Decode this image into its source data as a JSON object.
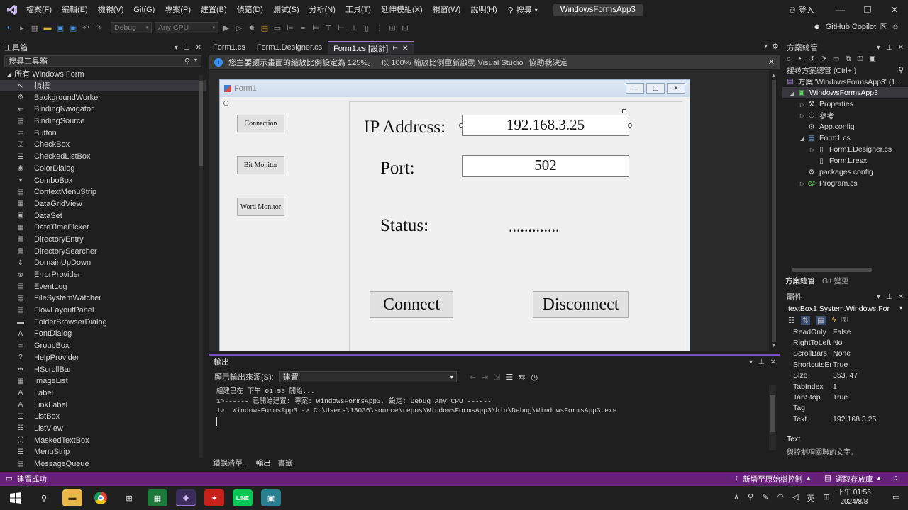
{
  "titlebar": {
    "menu": [
      "檔案(F)",
      "編輯(E)",
      "檢視(V)",
      "Git(G)",
      "專案(P)",
      "建置(B)",
      "偵錯(D)",
      "測試(S)",
      "分析(N)",
      "工具(T)",
      "延伸模組(X)",
      "視窗(W)",
      "說明(H)"
    ],
    "search_label": "搜尋",
    "solution_name": "WindowsFormsApp3",
    "signin": "登入"
  },
  "toolbar": {
    "config": "Debug",
    "platform": "Any CPU",
    "copilot": "GitHub Copilot"
  },
  "toolbox": {
    "title": "工具箱",
    "search_placeholder": "搜尋工具箱",
    "group": "所有 Windows Form",
    "items": [
      "指標",
      "BackgroundWorker",
      "BindingNavigator",
      "BindingSource",
      "Button",
      "CheckBox",
      "CheckedListBox",
      "ColorDialog",
      "ComboBox",
      "ContextMenuStrip",
      "DataGridView",
      "DataSet",
      "DateTimePicker",
      "DirectoryEntry",
      "DirectorySearcher",
      "DomainUpDown",
      "ErrorProvider",
      "EventLog",
      "FileSystemWatcher",
      "FlowLayoutPanel",
      "FolderBrowserDialog",
      "FontDialog",
      "GroupBox",
      "HelpProvider",
      "HScrollBar",
      "ImageList",
      "Label",
      "LinkLabel",
      "ListBox",
      "ListView",
      "MaskedTextBox",
      "MenuStrip",
      "MessageQueue"
    ]
  },
  "tabs": [
    "Form1.cs",
    "Form1.Designer.cs",
    "Form1.cs [設計]"
  ],
  "infobar": {
    "message": "您主要顯示畫面的縮放比例設定為 125%。",
    "link1": "以 100% 縮放比例重新啟動 Visual Studio",
    "link2": "協助我決定"
  },
  "form": {
    "title": "Form1",
    "buttons": [
      "Connection",
      "Bit Monitor",
      "Word Monitor"
    ],
    "ip_label": "IP Address:",
    "ip_value": "192.168.3.25",
    "port_label": "Port:",
    "port_value": "502",
    "status_label": "Status:",
    "status_value": ".............",
    "connect": "Connect",
    "disconnect": "Disconnect"
  },
  "output": {
    "title": "輸出",
    "source_label": "顯示輸出來源(S):",
    "source_value": "建置",
    "lines": [
      "組建已在 下午 01:56 開始...",
      "1>------ 已開始建置: 專案: WindowsFormsApp3, 設定: Debug Any CPU ------",
      "1>  WindowsFormsApp3 -> C:\\Users\\13036\\source\\repos\\WindowsFormsApp3\\bin\\Debug\\WindowsFormsApp3.exe"
    ],
    "tabs": [
      "錯誤清單...",
      "輸出",
      "書籤"
    ]
  },
  "solution_explorer": {
    "title": "方案總管",
    "search": "搜尋方案總管 (Ctrl+;)",
    "solution": "方案 'WindowsFormsApp3' (1...",
    "project": "WindowsFormsApp3",
    "nodes": [
      "Properties",
      "參考",
      "App.config",
      "Form1.cs",
      "Form1.Designer.cs",
      "Form1.resx",
      "packages.config",
      "Program.cs"
    ],
    "tabs": [
      "方案總管",
      "Git 變更"
    ]
  },
  "properties": {
    "title": "屬性",
    "object": "textBox1  System.Windows.For",
    "rows": [
      {
        "k": "ReadOnly",
        "v": "False"
      },
      {
        "k": "RightToLeft",
        "v": "No"
      },
      {
        "k": "ScrollBars",
        "v": "None"
      },
      {
        "k": "ShortcutsEnab",
        "v": "True"
      },
      {
        "k": "Size",
        "v": "353, 47"
      },
      {
        "k": "TabIndex",
        "v": "1"
      },
      {
        "k": "TabStop",
        "v": "True"
      },
      {
        "k": "Tag",
        "v": ""
      },
      {
        "k": "Text",
        "v": "192.168.3.25"
      }
    ],
    "desc_title": "Text",
    "desc": "與控制項關聯的文字。"
  },
  "statusbar": {
    "message": "建置成功",
    "add_source": "新增至原始檔控制",
    "select_repo": "選取存放庫"
  },
  "taskbar": {
    "ime": "英",
    "time": "下午 01:56",
    "date": "2024/8/8"
  }
}
